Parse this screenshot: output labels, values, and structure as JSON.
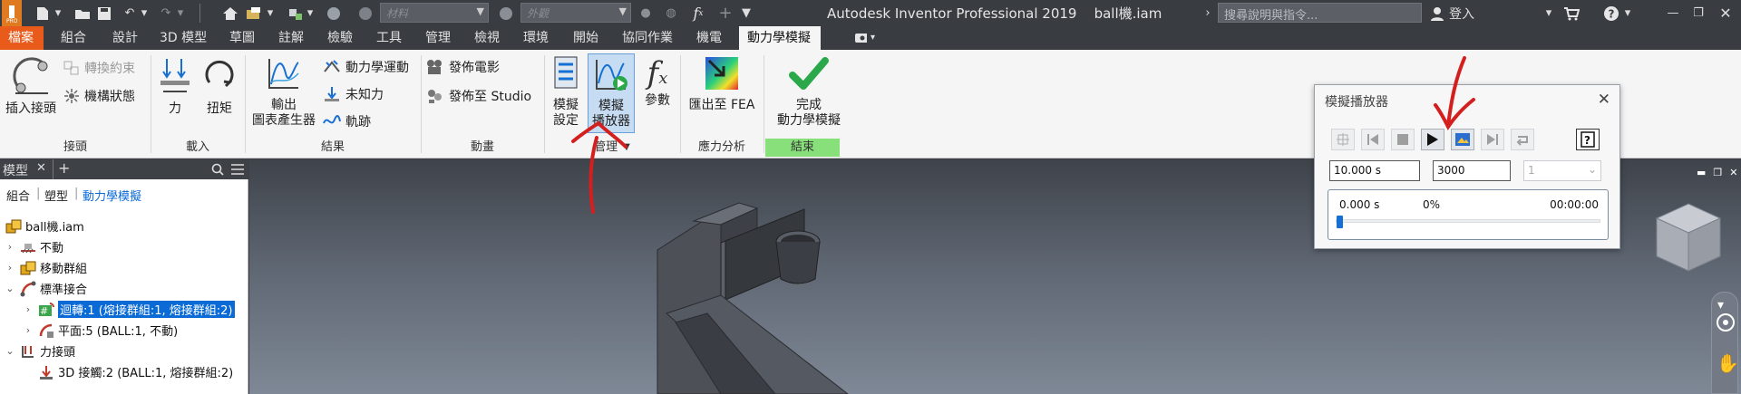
{
  "titlebar": {
    "app_title": "Autodesk Inventor Professional 2019",
    "document": "ball機.iam",
    "material_placeholder": "材料",
    "appearance_placeholder": "外觀",
    "search_placeholder": "搜尋說明與指令...",
    "sign_in": "登入"
  },
  "menu_tabs": [
    "檔案",
    "組合",
    "設計",
    "3D 模型",
    "草圖",
    "註解",
    "檢驗",
    "工具",
    "管理",
    "檢視",
    "環境",
    "開始",
    "協同作業",
    "機電",
    "動力學模擬"
  ],
  "ribbon": {
    "groups": {
      "joints": "接頭",
      "loads": "載入",
      "results": "結果",
      "animation": "動畫",
      "manage": "管理",
      "stress": "應力分析",
      "finish": "結束"
    },
    "buttons": {
      "insert_joint": "插入接頭",
      "convert_constraints": "轉換約束",
      "mechanism_status": "機構狀態",
      "force": "力",
      "torque": "扭矩",
      "output_1": "輸出",
      "output_2": "圖表產生器",
      "dynamic_motion": "動力學運動",
      "unknown_force": "未知力",
      "trace": "軌跡",
      "publish_movie": "發佈電影",
      "publish_studio": "發佈至 Studio",
      "sim_settings_1": "模擬",
      "sim_settings_2": "設定",
      "sim_player_1": "模擬",
      "sim_player_2": "播放器",
      "parameters": "參數",
      "export_fea": "匯出至 FEA",
      "finish_1": "完成",
      "finish_2": "動力學模擬"
    }
  },
  "browser": {
    "title": "模型",
    "subtabs": [
      "組合",
      "塑型",
      "動力學模擬"
    ],
    "tree": [
      {
        "label": "ball機.iam",
        "level": 0,
        "expander": "",
        "icon": "assembly-icon"
      },
      {
        "label": "不動",
        "level": 1,
        "expander": "›",
        "icon": "grounded-icon"
      },
      {
        "label": "移動群組",
        "level": 1,
        "expander": "›",
        "icon": "mobile-group-icon"
      },
      {
        "label": "標準接合",
        "level": 1,
        "expander": "⌄",
        "icon": "standard-joint-icon"
      },
      {
        "label": "迴轉:1 (熔接群組:1, 熔接群組:2)",
        "level": 2,
        "expander": "›",
        "icon": "revolution-joint-icon",
        "selected": true
      },
      {
        "label": "平面:5 (BALL:1, 不動)",
        "level": 2,
        "expander": "›",
        "icon": "planar-joint-icon"
      },
      {
        "label": "力接頭",
        "level": 1,
        "expander": "⌄",
        "icon": "force-joint-icon"
      },
      {
        "label": "3D 接觸:2 (BALL:1, 熔接群組:2)",
        "level": 2,
        "expander": "",
        "icon": "contact-joint-icon"
      }
    ]
  },
  "sim_player": {
    "title": "模擬播放器",
    "end_time": "10.000 s",
    "images": "3000",
    "filter": "1",
    "current_time": "0.000 s",
    "percent": "0%",
    "elapsed": "00:00:00",
    "progress": 0
  },
  "navbar_icons": [
    "full-navigation-wheel-icon",
    "pan-icon"
  ],
  "colors": {
    "accent": "#0696d7",
    "file_tab": "#e85b1a",
    "finish_green": "#88e07a",
    "annotation_red": "#d41f1f"
  }
}
